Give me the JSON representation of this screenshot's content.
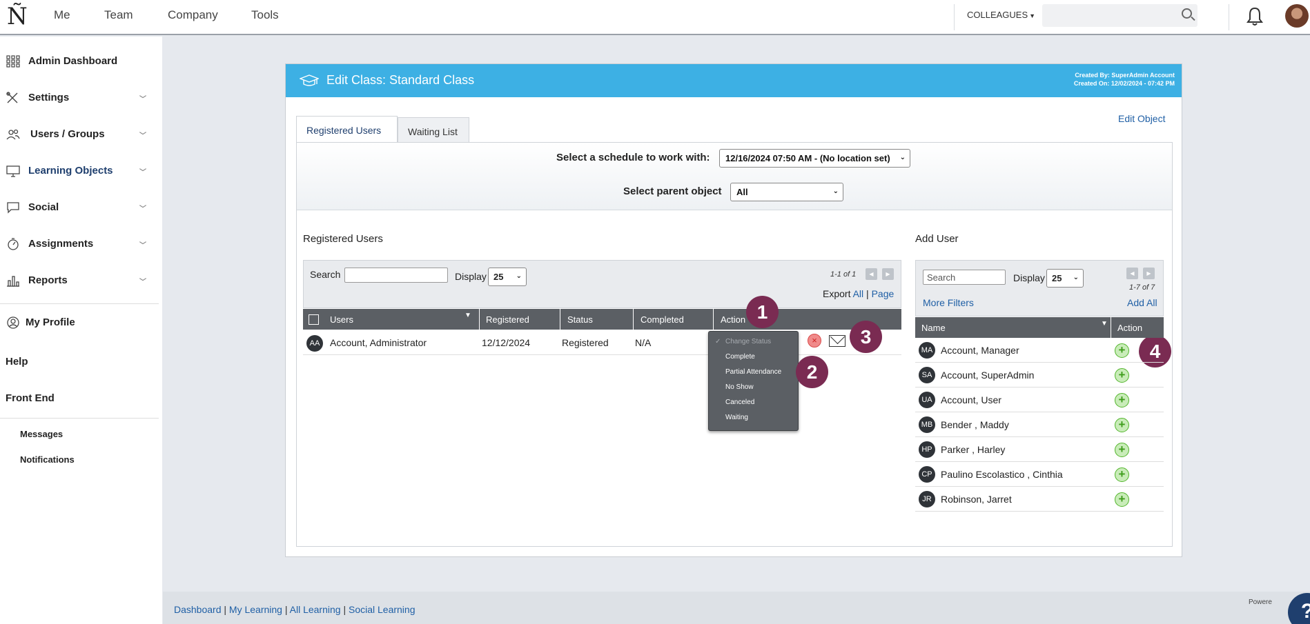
{
  "topnav": {
    "logo": "Ñ",
    "items": [
      "Me",
      "Team",
      "Company",
      "Tools"
    ],
    "colleagues": "COLLEAGUES"
  },
  "sidebar": {
    "items": [
      {
        "label": "Admin Dashboard",
        "icon": "grid-icon"
      },
      {
        "label": "Settings",
        "icon": "tools-icon"
      },
      {
        "label": "Users / Groups",
        "icon": "users-icon"
      },
      {
        "label": "Learning Objects",
        "icon": "monitor-icon"
      },
      {
        "label": "Social",
        "icon": "chat-icon"
      },
      {
        "label": "Assignments",
        "icon": "stopwatch-icon"
      },
      {
        "label": "Reports",
        "icon": "bar-chart-icon"
      }
    ],
    "my_profile": "My Profile",
    "help": "Help",
    "front_end": "Front End",
    "messages": "Messages",
    "notifications": "Notifications"
  },
  "panel": {
    "title": "Edit Class: Standard Class",
    "created_by": "Created By: SuperAdmin Account",
    "created_on": "Created On: 12/02/2024 - 07:42 PM",
    "edit_object": "Edit Object",
    "tabs": [
      "Registered Users",
      "Waiting List"
    ],
    "schedule_label": "Select a schedule to work with:",
    "schedule_value": "12/16/2024 07:50 AM - (No location set)",
    "parent_label": "Select parent object",
    "parent_value": "All"
  },
  "registered": {
    "title": "Registered Users",
    "search_label": "Search",
    "display_label": "Display",
    "display_value": "25",
    "pager": "1-1 of 1",
    "export_label": "Export",
    "export_all": "All",
    "export_sep": "|",
    "export_page": "Page",
    "columns": [
      "Users",
      "Registered",
      "Status",
      "Completed",
      "Action"
    ],
    "rows": [
      {
        "initials": "AA",
        "name": "Account, Administrator",
        "registered": "12/12/2024",
        "status": "Registered",
        "completed": "N/A"
      }
    ]
  },
  "status_menu": {
    "options": [
      "Change Status",
      "Complete",
      "Partial Attendance",
      "No Show",
      "Canceled",
      "Waiting"
    ]
  },
  "badges": [
    "1",
    "2",
    "3",
    "4"
  ],
  "add_user": {
    "title": "Add User",
    "search_placeholder": "Search",
    "display_label": "Display",
    "display_value": "25",
    "pager": "1-7 of 7",
    "more_filters": "More Filters",
    "add_all": "Add All",
    "columns": [
      "Name",
      "Action"
    ],
    "rows": [
      {
        "initials": "MA",
        "name": "Account, Manager"
      },
      {
        "initials": "SA",
        "name": "Account, SuperAdmin"
      },
      {
        "initials": "UA",
        "name": "Account, User"
      },
      {
        "initials": "MB",
        "name": "Bender , Maddy"
      },
      {
        "initials": "HP",
        "name": "Parker , Harley"
      },
      {
        "initials": "CP",
        "name": "Paulino Escolastico , Cinthia"
      },
      {
        "initials": "JR",
        "name": "Robinson, Jarret"
      }
    ]
  },
  "footer": {
    "links": [
      "Dashboard",
      "My Learning",
      "All Learning",
      "Social Learning"
    ],
    "powered": "Powere",
    "help_fab": "?"
  },
  "colors": {
    "header_blue": "#3db0e4",
    "nav_dark": "#1f3f6e",
    "badge": "#7a2b52",
    "grid_header": "#5b5f64"
  }
}
